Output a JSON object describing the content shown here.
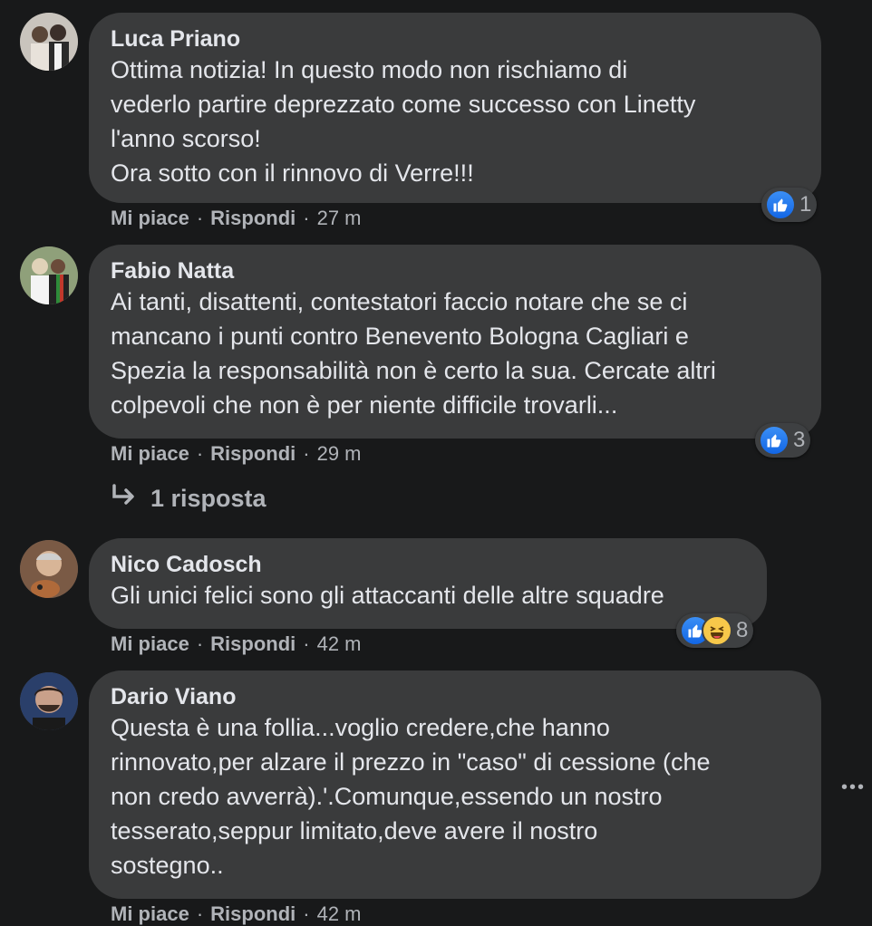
{
  "comments": [
    {
      "author": "Luca Priano",
      "text": "Ottima notizia! In questo modo non rischiamo di\nvederlo partire deprezzato come successo con Linetty\nl'anno scorso!\nOra sotto con il rinnovo di Verre!!!",
      "like_label": "Mi piace",
      "reply_label": "Rispondi",
      "time": "27 m",
      "reaction_count": "1",
      "reactions": [
        "like-icon"
      ]
    },
    {
      "author": "Fabio Natta",
      "text": "Ai tanti, disattenti, contestatori faccio notare che se ci\nmancano i punti contro Benevento Bologna Cagliari e\nSpezia la responsabilità non è certo la sua. Cercate altri\ncolpevoli che non è per niente difficile trovarli...",
      "like_label": "Mi piace",
      "reply_label": "Rispondi",
      "time": "29 m",
      "reaction_count": "3",
      "reactions": [
        "like-icon"
      ],
      "replies_label": "1 risposta"
    },
    {
      "author": "Nico Cadosch",
      "text": "Gli unici felici sono gli attaccanti delle altre squadre",
      "like_label": "Mi piace",
      "reply_label": "Rispondi",
      "time": "42 m",
      "reaction_count": "8",
      "reactions": [
        "like-icon",
        "haha-icon"
      ]
    },
    {
      "author": "Dario Viano",
      "text": "Questa è una follia...voglio credere,che hanno\nrinnovato,per alzare il prezzo in \"caso\" di cessione (che\nnon credo avverrà).'.Comunque,essendo un nostro\ntesserato,seppur limitato,deve avere il nostro\nsostegno..",
      "like_label": "Mi piace",
      "reply_label": "Rispondi",
      "time": "42 m"
    }
  ],
  "more_options": "•••",
  "colors": {
    "background": "#18191a",
    "bubble": "#3a3b3c",
    "text": "#e4e6eb",
    "secondary": "#b0b3b8",
    "like_blue": "#1877f2"
  }
}
